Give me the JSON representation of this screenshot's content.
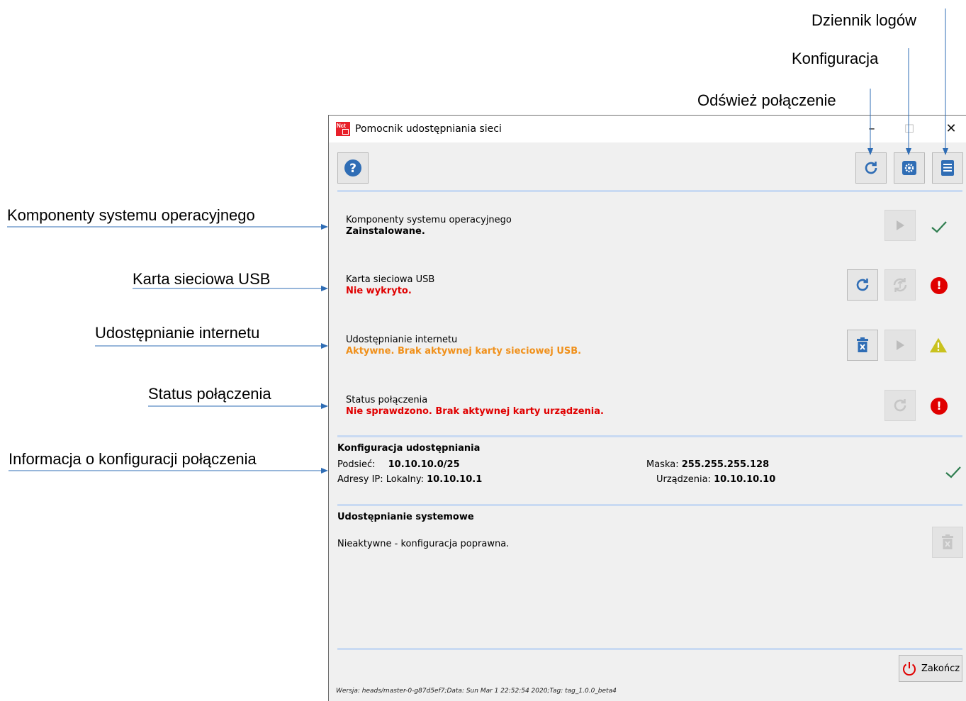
{
  "annotations": {
    "log_journal": "Dziennik logów",
    "configuration": "Konfiguracja",
    "refresh_connection": "Odśwież połączenie",
    "os_components": "Komponenty systemu operacyjnego",
    "usb_card": "Karta sieciowa USB",
    "internet_sharing": "Udostępnianie internetu",
    "connection_status": "Status połączenia",
    "config_info": "Informacja o konfiguracji połączenia"
  },
  "window": {
    "title": "Pomocnik udostępniania sieci",
    "app_icon_text": "Nct",
    "minimize": "–",
    "maximize": "☐",
    "close": "✕"
  },
  "rows": [
    {
      "title": "Komponenty systemu operacyjnego",
      "status": "Zainstalowane.",
      "status_color": "#000000",
      "state": "ok"
    },
    {
      "title": "Karta sieciowa USB",
      "status": "Nie wykryto.",
      "status_color": "#e00000",
      "state": "error"
    },
    {
      "title": "Udostępnianie internetu",
      "status": "Aktywne. Brak aktywnej karty sieciowej USB.",
      "status_color": "#f0901a",
      "state": "warning"
    },
    {
      "title": "Status połączenia",
      "status": "Nie sprawdzono. Brak aktywnej karty urządzenia.",
      "status_color": "#e00000",
      "state": "error"
    }
  ],
  "config": {
    "title": "Konfiguracja udostępniania",
    "subnet_label": "Podsieć:",
    "subnet_value": "10.10.10.0/25",
    "mask_label": "Maska:",
    "mask_value": "255.255.255.128",
    "ip_label": "Adresy IP: Lokalny:",
    "ip_value": "10.10.10.1",
    "device_label": "Urządzenia:",
    "device_value": "10.10.10.10"
  },
  "system_sharing": {
    "title": "Udostępnianie systemowe",
    "status": "Nieaktywne - konfiguracja poprawna."
  },
  "footer": {
    "quit_label": "Zakończ",
    "version": "Wersja: heads/master-0-g87d5ef7;Data: Sun Mar 1 22:52:54 2020;Tag: tag_1.0.0_beta4"
  },
  "colors": {
    "accent_blue": "#2f6db5",
    "error_red": "#e00000",
    "warning_orange": "#f0901a",
    "ok_green": "#2e7d4f",
    "separator": "#c9daf2"
  }
}
